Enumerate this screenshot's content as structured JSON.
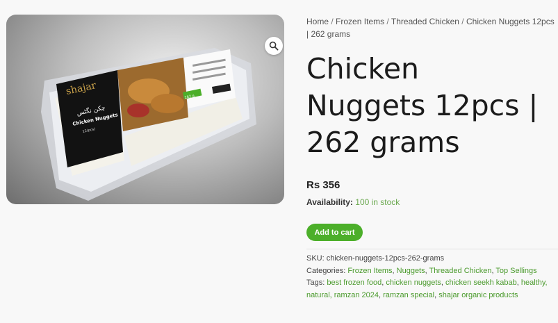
{
  "breadcrumb": {
    "home": "Home",
    "sep": "/",
    "frozen": "Frozen Items",
    "threaded": "Threaded Chicken",
    "current": "Chicken Nuggets 12pcs | 262 grams"
  },
  "product": {
    "title_line1": "Chicken",
    "title_line2": "Nuggets 12pcs |",
    "title_line3": "262 grams",
    "price": "Rs 356",
    "availability_label": "Availability:",
    "availability_value": "100 in stock",
    "add_to_cart": "Add to cart"
  },
  "image": {
    "brand": "shajar",
    "urdu_name": "چکن نگٹس",
    "name": "Chicken Nuggets",
    "pieces": "12(pcs)",
    "weight": "262 g",
    "zoom_icon": "magnifier-icon"
  },
  "meta": {
    "sku_label": "SKU:",
    "sku_value": "chicken-nuggets-12pcs-262-grams",
    "categories_label": "Categories:",
    "categories": [
      "Frozen Items",
      "Nuggets",
      "Threaded Chicken",
      "Top Sellings"
    ],
    "tags_label": "Tags:",
    "tags": [
      "best frozen food",
      "chicken nuggets",
      "chicken seekh kabab",
      "healthy,",
      "natural,",
      "ramzan 2024",
      "ramzan special",
      "shajar organic products"
    ]
  },
  "colors": {
    "accent": "#4caf2a",
    "link": "#4a9a2c"
  }
}
